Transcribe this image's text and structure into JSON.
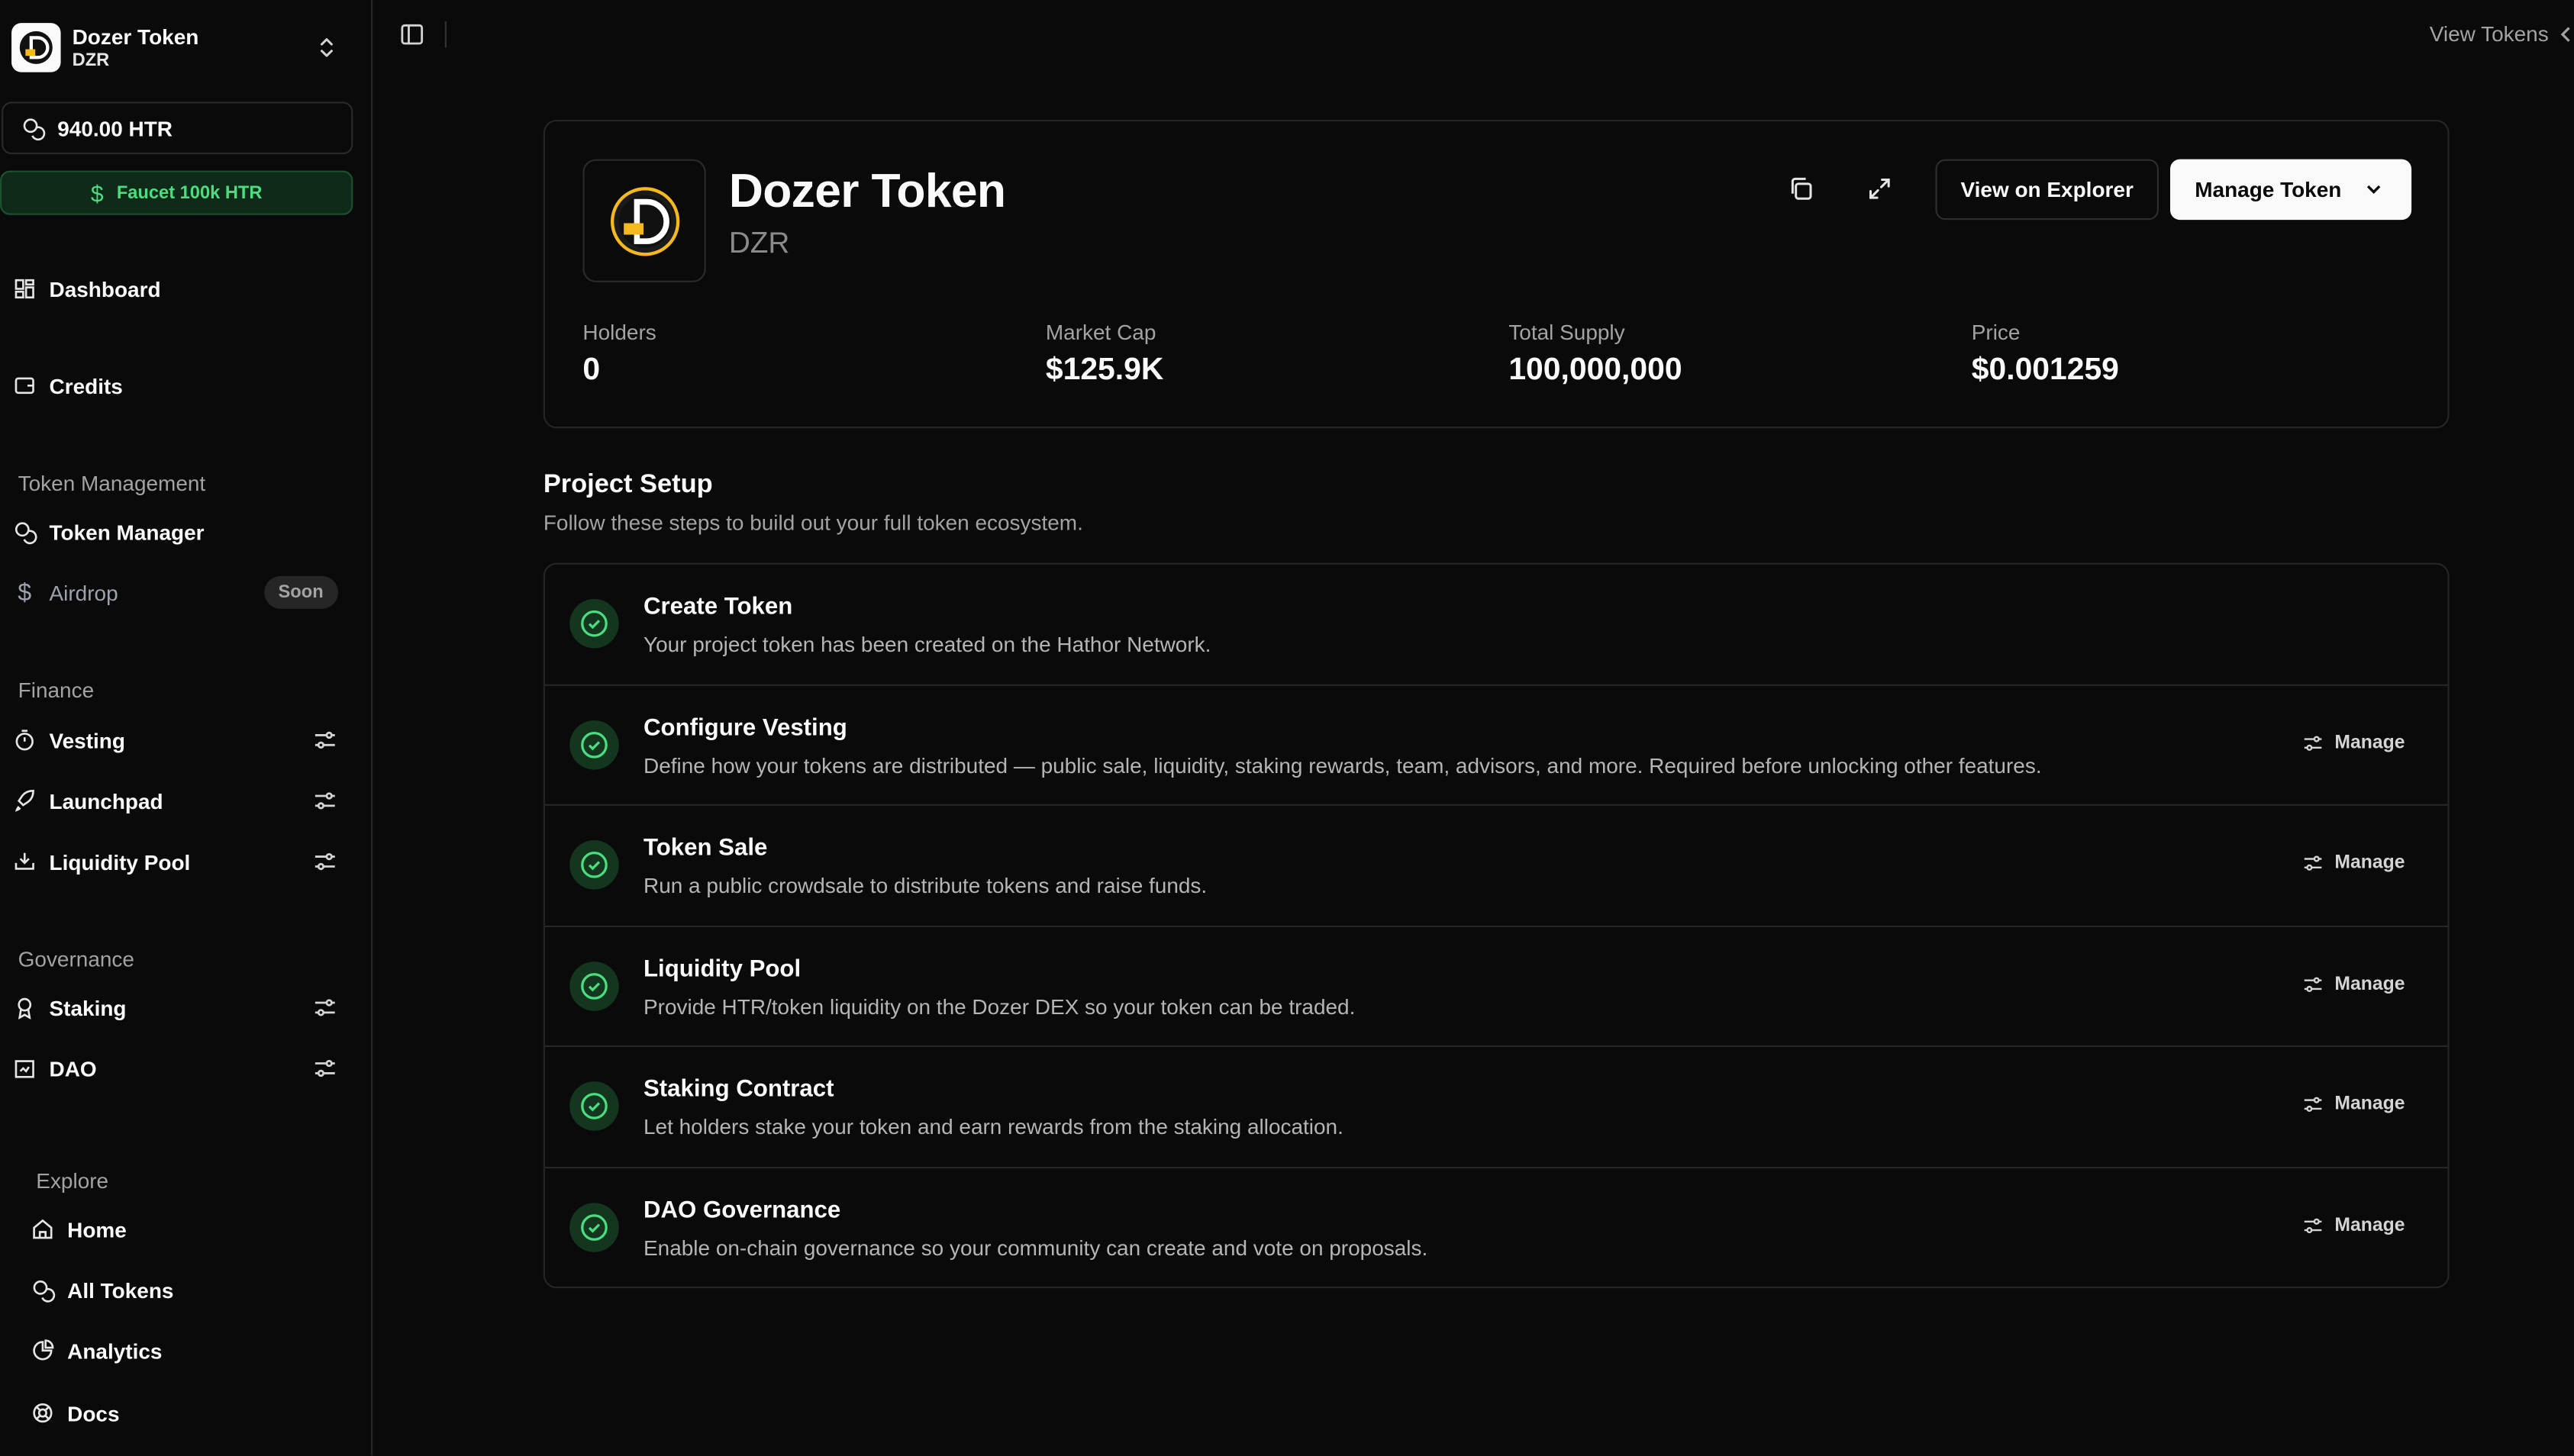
{
  "workspace": {
    "name": "Dozer Token",
    "symbol": "DZR"
  },
  "sidebar": {
    "balance": "940.00 HTR",
    "faucet_label": "Faucet 100k HTR",
    "top_items": [
      {
        "label": "Dashboard",
        "icon": "dashboard-icon"
      },
      {
        "label": "Credits",
        "icon": "wallet-icon"
      }
    ],
    "sections": [
      {
        "title": "Token Management",
        "items": [
          {
            "label": "Token Manager",
            "icon": "coins-icon"
          },
          {
            "label": "Airdrop",
            "icon": "dollar-icon",
            "badge": "Soon"
          }
        ]
      },
      {
        "title": "Finance",
        "items": [
          {
            "label": "Vesting",
            "icon": "timer-icon"
          },
          {
            "label": "Launchpad",
            "icon": "rocket-icon"
          },
          {
            "label": "Liquidity Pool",
            "icon": "pool-icon"
          }
        ]
      },
      {
        "title": "Governance",
        "items": [
          {
            "label": "Staking",
            "icon": "award-icon"
          },
          {
            "label": "DAO",
            "icon": "landmark-icon"
          }
        ]
      },
      {
        "title": "Explore",
        "items": [
          {
            "label": "Home",
            "icon": "home-icon"
          },
          {
            "label": "All Tokens",
            "icon": "coins-icon"
          },
          {
            "label": "Analytics",
            "icon": "pie-chart-icon"
          },
          {
            "label": "Docs",
            "icon": "life-buoy-icon"
          }
        ]
      }
    ]
  },
  "topbar": {
    "view_tokens": "View Tokens"
  },
  "token": {
    "name": "Dozer Token",
    "symbol": "DZR",
    "view_on_explorer": "View on Explorer",
    "manage_token": "Manage Token",
    "stats": [
      {
        "label": "Holders",
        "value": "0"
      },
      {
        "label": "Market Cap",
        "value": "$125.9K"
      },
      {
        "label": "Total Supply",
        "value": "100,000,000"
      },
      {
        "label": "Price",
        "value": "$0.001259"
      }
    ]
  },
  "setup": {
    "title": "Project Setup",
    "subtitle": "Follow these steps to build out your full token ecosystem.",
    "manage_label": "Manage",
    "steps": [
      {
        "title": "Create Token",
        "desc": "Your project token has been created on the Hathor Network."
      },
      {
        "title": "Configure Vesting",
        "desc": "Define how your tokens are distributed — public sale, liquidity, staking rewards, team, advisors, and more. Required before unlocking other features."
      },
      {
        "title": "Token Sale",
        "desc": "Run a public crowdsale to distribute tokens and raise funds."
      },
      {
        "title": "Liquidity Pool",
        "desc": "Provide HTR/token liquidity on the Dozer DEX so your token can be traded."
      },
      {
        "title": "Staking Contract",
        "desc": "Let holders stake your token and earn rewards from the staking allocation."
      },
      {
        "title": "DAO Governance",
        "desc": "Enable on-chain governance so your community can create and vote on proposals."
      }
    ]
  },
  "colors": {
    "accent_green": "#4ade80",
    "brand_gold": "#f5b91f"
  }
}
